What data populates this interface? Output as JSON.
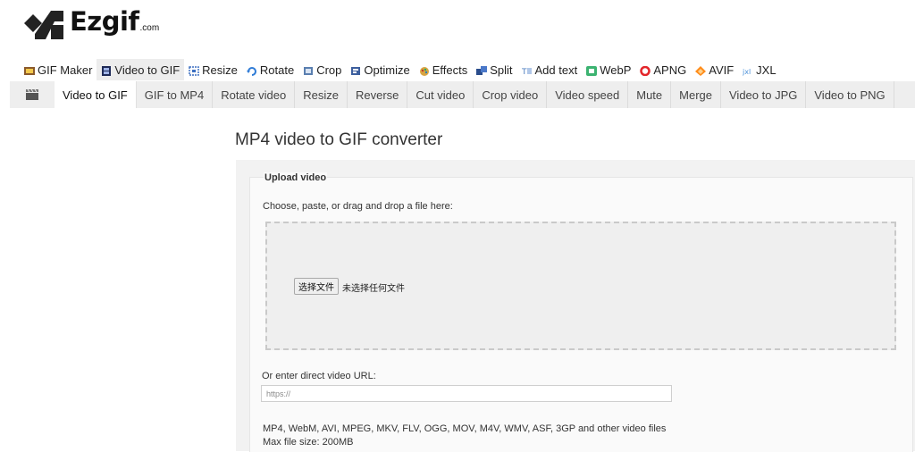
{
  "logo": {
    "name": "Ezgif",
    "suffix": ".com"
  },
  "top_menu": [
    {
      "label": "GIF Maker",
      "icon": "gif-maker-icon",
      "active": false
    },
    {
      "label": "Video to GIF",
      "icon": "film-icon",
      "active": true
    },
    {
      "label": "Resize",
      "icon": "resize-icon",
      "active": false
    },
    {
      "label": "Rotate",
      "icon": "rotate-icon",
      "active": false
    },
    {
      "label": "Crop",
      "icon": "crop-icon",
      "active": false
    },
    {
      "label": "Optimize",
      "icon": "optimize-icon",
      "active": false
    },
    {
      "label": "Effects",
      "icon": "effects-icon",
      "active": false
    },
    {
      "label": "Split",
      "icon": "split-icon",
      "active": false
    },
    {
      "label": "Add text",
      "icon": "add-text-icon",
      "active": false
    },
    {
      "label": "WebP",
      "icon": "webp-icon",
      "active": false
    },
    {
      "label": "APNG",
      "icon": "apng-icon",
      "active": false
    },
    {
      "label": "AVIF",
      "icon": "avif-icon",
      "active": false
    },
    {
      "label": "JXL",
      "icon": "jxl-icon",
      "active": false
    }
  ],
  "sub_nav": {
    "icon": "clapperboard-icon",
    "items": [
      {
        "label": "Video to GIF",
        "active": true
      },
      {
        "label": "GIF to MP4",
        "active": false
      },
      {
        "label": "Rotate video",
        "active": false
      },
      {
        "label": "Resize",
        "active": false
      },
      {
        "label": "Reverse",
        "active": false
      },
      {
        "label": "Cut video",
        "active": false
      },
      {
        "label": "Crop video",
        "active": false
      },
      {
        "label": "Video speed",
        "active": false
      },
      {
        "label": "Mute",
        "active": false
      },
      {
        "label": "Merge",
        "active": false
      },
      {
        "label": "Video to JPG",
        "active": false
      },
      {
        "label": "Video to PNG",
        "active": false
      }
    ]
  },
  "main": {
    "title": "MP4 video to GIF converter",
    "upload_legend": "Upload video",
    "choose_label": "Choose, paste, or drag and drop a file here:",
    "file_button": "选择文件",
    "file_status": "未选择任何文件",
    "url_label": "Or enter direct video URL:",
    "url_placeholder": "https://",
    "url_value": "",
    "formats": "MP4, WebM, AVI, MPEG, MKV, FLV, OGG, MOV, M4V, WMV, ASF, 3GP and other video files",
    "max_size": "Max file size: 200MB"
  },
  "colors": {
    "active_tab_bg": "#ededed",
    "subnav_bg": "#eeeeee",
    "panel_bg": "#f2f2f2",
    "webp_green": "#3cb371",
    "apng_red": "#e3262b",
    "avif_orange": "#ff8c1a",
    "jxl_blue": "#4a90d9"
  }
}
